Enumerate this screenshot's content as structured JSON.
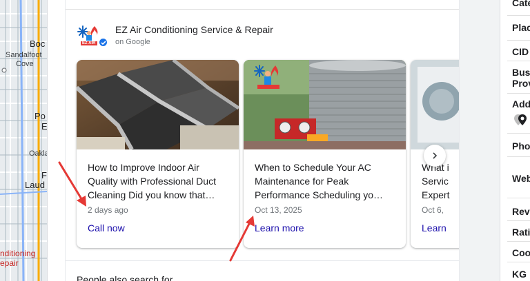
{
  "map": {
    "labels": [
      "Boc",
      "Sandalfoot",
      "Cove",
      "Po",
      "E",
      "Oakla",
      "Laud",
      "F",
      "nditioning",
      "epair"
    ]
  },
  "business": {
    "name": "EZ Air Conditioning Service & Repair",
    "source": "on Google",
    "logo_text": "EZ AIR"
  },
  "posts": [
    {
      "title": "How to Improve Indoor Air Quality with Professional Duct Cleaning Did you know that…",
      "date": "2 days ago",
      "cta": "Call now"
    },
    {
      "title": "When to Schedule Your AC Maintenance for Peak Performance Scheduling yo…",
      "date": "Oct 13, 2025",
      "cta": "Learn more"
    },
    {
      "title": "What i Servic Expert",
      "date": "Oct 6,",
      "cta": "Learn"
    }
  ],
  "next_section_title": "People also search for",
  "sidebar": {
    "items": [
      "Cate",
      "Plac",
      "CID",
      "Busi",
      "Prov",
      "Add",
      "Phon",
      "Web",
      "Rev",
      "Rati",
      "Coo",
      "KG"
    ]
  },
  "colors": {
    "link": "#1a0dab",
    "arrow": "#e53935",
    "verified": "#1a73e8"
  },
  "icons": {
    "next": "chevron-right-icon",
    "verified": "verified-badge-icon",
    "pin": "location-pin-icon"
  }
}
